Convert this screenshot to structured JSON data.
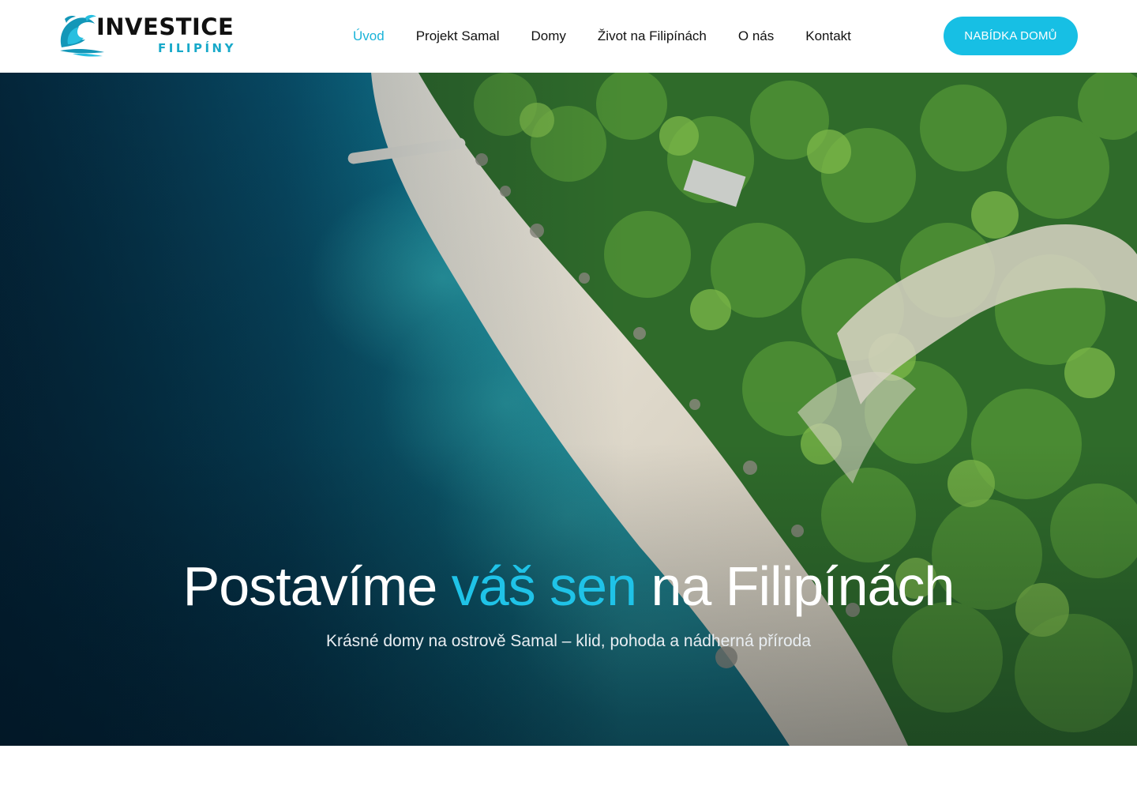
{
  "brand": {
    "name": "INVESTICE",
    "subname": "FILIPÍNY",
    "logo_icon": "wave-logo-icon",
    "accent_color": "#17bfe4"
  },
  "nav": {
    "items": [
      {
        "label": "Úvod",
        "active": true
      },
      {
        "label": "Projekt Samal",
        "active": false
      },
      {
        "label": "Domy",
        "active": false
      },
      {
        "label": "Život na Filipínách",
        "active": false
      },
      {
        "label": "O nás",
        "active": false
      },
      {
        "label": "Kontakt",
        "active": false
      }
    ],
    "cta_label": "NABÍDKA DOMŮ"
  },
  "hero": {
    "title_before": "Postavíme",
    "title_highlight": "váš sen",
    "title_after": "na Filipínách",
    "subtitle": "Krásné domy na ostrově Samal – klid, pohoda a nádherná příroda",
    "background": "aerial-tropical-coast-image"
  }
}
